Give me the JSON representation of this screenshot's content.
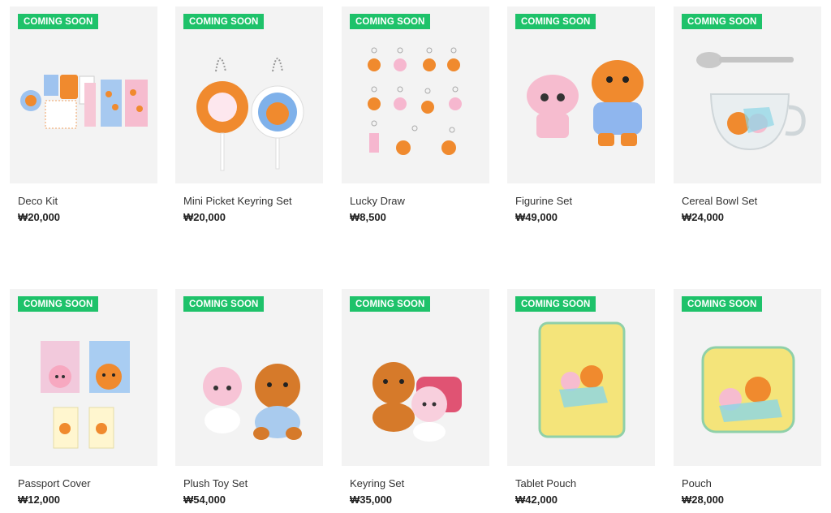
{
  "products": [
    {
      "badge": "COMING SOON",
      "name": "Deco Kit",
      "price": "₩20,000",
      "art": "deco-kit"
    },
    {
      "badge": "COMING SOON",
      "name": "Mini Picket Keyring Set",
      "price": "₩20,000",
      "art": "picket-keyring"
    },
    {
      "badge": "COMING SOON",
      "name": "Lucky Draw",
      "price": "₩8,500",
      "art": "lucky-draw"
    },
    {
      "badge": "COMING SOON",
      "name": "Figurine Set",
      "price": "₩49,000",
      "art": "figurine"
    },
    {
      "badge": "COMING SOON",
      "name": "Cereal Bowl Set",
      "price": "₩24,000",
      "art": "cereal-bowl"
    },
    {
      "badge": "COMING SOON",
      "name": "Passport Cover",
      "price": "₩12,000",
      "art": "passport"
    },
    {
      "badge": "COMING SOON",
      "name": "Plush Toy Set",
      "price": "₩54,000",
      "art": "plush"
    },
    {
      "badge": "COMING SOON",
      "name": "Keyring Set",
      "price": "₩35,000",
      "art": "keyring"
    },
    {
      "badge": "COMING SOON",
      "name": "Tablet Pouch",
      "price": "₩42,000",
      "art": "tablet-pouch"
    },
    {
      "badge": "COMING SOON",
      "name": "Pouch",
      "price": "₩28,000",
      "art": "pouch"
    }
  ],
  "colors": {
    "badge": "#1ec26a",
    "thumb_bg": "#f3f3f3",
    "tiger": "#f08a2e",
    "pink": "#f6b7cf",
    "blue": "#8fb6ee",
    "yellow": "#f4e47a"
  }
}
